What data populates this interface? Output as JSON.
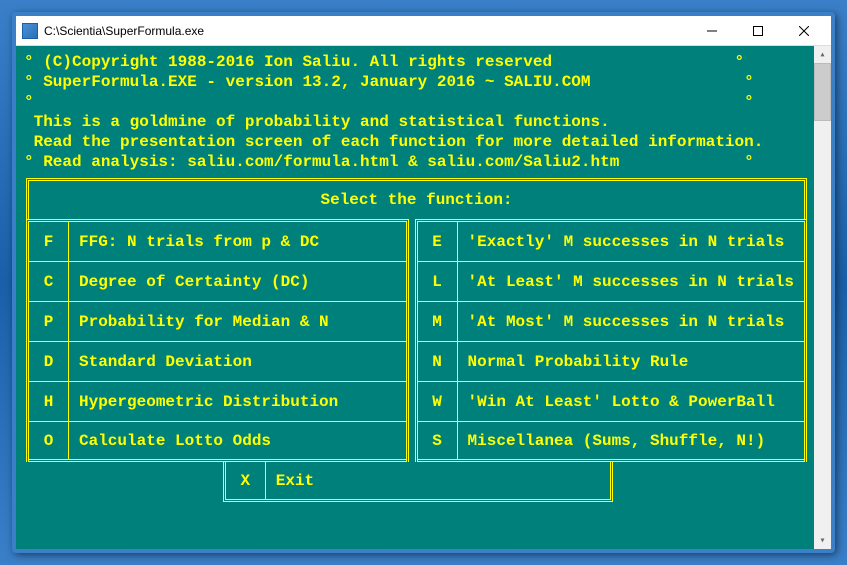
{
  "window": {
    "title": "C:\\Scientia\\SuperFormula.exe"
  },
  "header_lines": {
    "l0": "° (C)Copyright 1988-2016 Ion Saliu. All rights reserved                   °",
    "l1": "° SuperFormula.EXE - version 13.2, January 2016 ~ SALIU.COM                °",
    "l2": "°                                                                          °",
    "l3": " This is a goldmine of probability and statistical functions.",
    "l4": " Read the presentation screen of each function for more detailed information.",
    "l5": "° Read analysis: saliu.com/formula.html & saliu.com/Saliu2.htm             °"
  },
  "menu": {
    "title": "Select the function:",
    "left": [
      {
        "key": "F",
        "label": "FFG: N trials from p & DC"
      },
      {
        "key": "C",
        "label": "Degree of Certainty (DC)"
      },
      {
        "key": "P",
        "label": "Probability for Median & N"
      },
      {
        "key": "D",
        "label": "Standard Deviation"
      },
      {
        "key": "H",
        "label": "Hypergeometric Distribution"
      },
      {
        "key": "O",
        "label": "Calculate Lotto Odds"
      }
    ],
    "right": [
      {
        "key": "E",
        "label": "'Exactly' M successes in N trials"
      },
      {
        "key": "L",
        "label": "'At Least' M successes in N trials"
      },
      {
        "key": "M",
        "label": "'At Most' M successes in N trials"
      },
      {
        "key": "N",
        "label": "Normal Probability Rule"
      },
      {
        "key": "W",
        "label": "'Win At Least' Lotto & PowerBall"
      },
      {
        "key": "S",
        "label": "Miscellanea (Sums, Shuffle, N!)"
      }
    ],
    "exit": {
      "key": "X",
      "label": "Exit"
    }
  }
}
